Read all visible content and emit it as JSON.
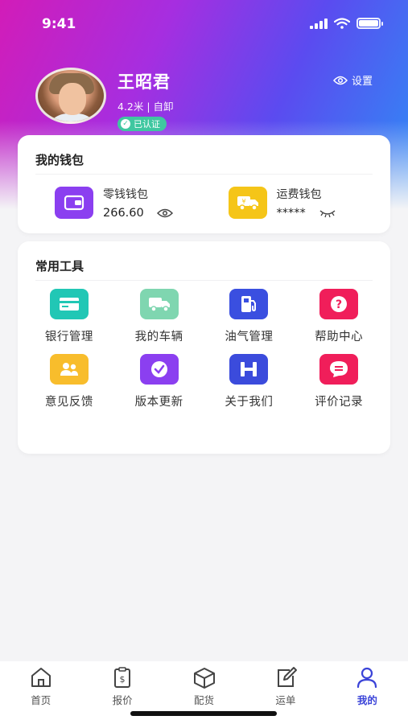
{
  "status_bar": {
    "time": "9:41"
  },
  "profile": {
    "name": "王昭君",
    "meta": "4.2米 | 自卸",
    "verified_label": "已认证",
    "settings_label": "设置"
  },
  "wallet": {
    "title": "我的钱包",
    "items": [
      {
        "label": "零钱钱包",
        "value": "266.60",
        "icon": "wallet-icon",
        "color": "#8b3ff0"
      },
      {
        "label": "运费钱包",
        "value": "*****",
        "icon": "truck-icon",
        "color": "#f5c518"
      }
    ]
  },
  "tools": {
    "title": "常用工具",
    "items": [
      {
        "label": "银行管理",
        "icon": "bank-card-icon",
        "color": "#21c7b5"
      },
      {
        "label": "我的车辆",
        "icon": "truck-icon",
        "color": "#7fd6b0"
      },
      {
        "label": "油气管理",
        "icon": "fuel-pump-icon",
        "color": "#3a4fe0"
      },
      {
        "label": "帮助中心",
        "icon": "help-icon",
        "color": "#f01e5a"
      },
      {
        "label": "意见反馈",
        "icon": "feedback-icon",
        "color": "#f8bd2c"
      },
      {
        "label": "版本更新",
        "icon": "update-check-icon",
        "color": "#8b3ff0"
      },
      {
        "label": "关于我们",
        "icon": "about-icon",
        "color": "#3b4bdc"
      },
      {
        "label": "评价记录",
        "icon": "review-icon",
        "color": "#f01e5a"
      }
    ]
  },
  "tabbar": {
    "active_color": "#3b44d8",
    "items": [
      {
        "label": "首页",
        "icon": "home-icon"
      },
      {
        "label": "报价",
        "icon": "quote-icon"
      },
      {
        "label": "配货",
        "icon": "package-icon"
      },
      {
        "label": "运单",
        "icon": "edit-icon"
      },
      {
        "label": "我的",
        "icon": "user-icon",
        "active": true
      }
    ]
  }
}
